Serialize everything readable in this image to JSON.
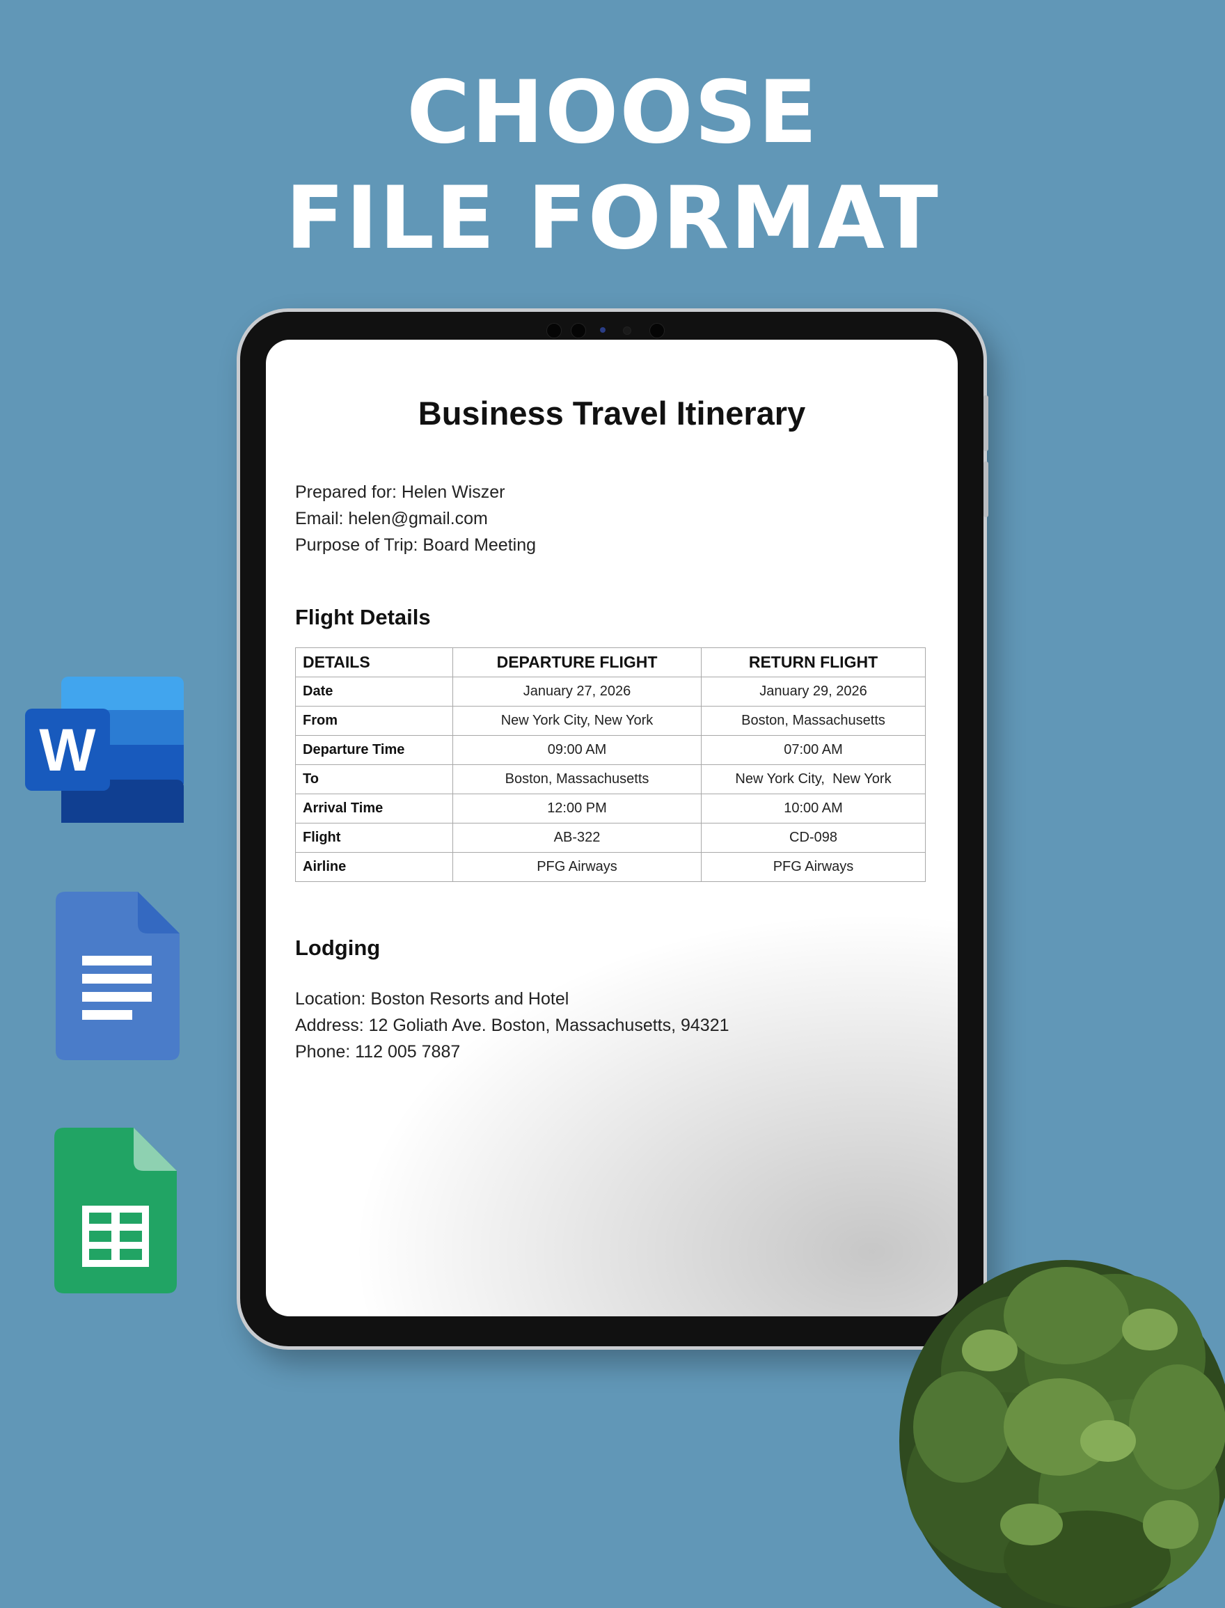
{
  "headline": {
    "line1": "CHOOSE",
    "line2": "FILE FORMAT"
  },
  "format_icons": [
    "microsoft-word-icon",
    "google-docs-icon",
    "google-sheets-icon"
  ],
  "word_icon_letter": "W",
  "document": {
    "title": "Business Travel Itinerary",
    "prepared_for": "Prepared for: Helen Wiszer",
    "email": "Email: helen@gmail.com",
    "purpose": "Purpose of Trip: Board Meeting",
    "flight_section": "Flight Details",
    "flight_table": {
      "headers": [
        "DETAILS",
        "DEPARTURE FLIGHT",
        "RETURN FLIGHT"
      ],
      "rows": [
        [
          "Date",
          "January 27, 2026",
          "January 29, 2026"
        ],
        [
          "From",
          "New York City, New York",
          "Boston, Massachusetts"
        ],
        [
          "Departure Time",
          "09:00 AM",
          "07:00 AM"
        ],
        [
          "To",
          "Boston, Massachusetts",
          "New York City,  New York"
        ],
        [
          "Arrival Time",
          "12:00 PM",
          "10:00 AM"
        ],
        [
          "Flight",
          "AB-322",
          "CD-098"
        ],
        [
          "Airline",
          "PFG Airways",
          "PFG Airways"
        ]
      ]
    },
    "lodging_section": "Lodging",
    "location": "Location: Boston Resorts and Hotel",
    "address": "Address: 12 Goliath Ave. Boston, Massachusetts, 94321",
    "phone": "Phone: 112 005 7887"
  },
  "colors": {
    "background": "#6197b7",
    "word_blue": "#2b579a",
    "docs_blue": "#4a7cc9",
    "sheets_green": "#21a464"
  }
}
